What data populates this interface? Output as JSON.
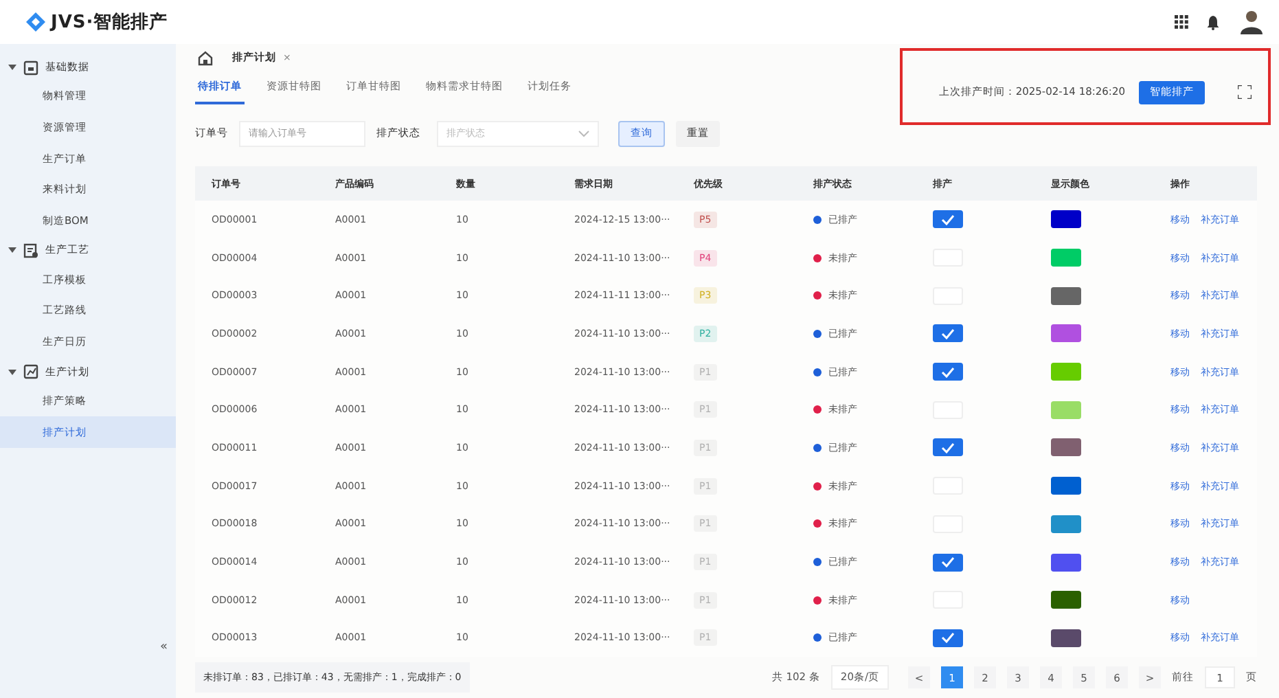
{
  "app": {
    "logo_text": "JVS·智能排产"
  },
  "sidebar": {
    "groups": [
      {
        "label": "基础数据",
        "expanded": true,
        "children": [
          {
            "label": "物料管理",
            "selected": false
          },
          {
            "label": "资源管理",
            "selected": false
          },
          {
            "label": "生产订单",
            "selected": false
          },
          {
            "label": "来料计划",
            "selected": false
          },
          {
            "label": "制造BOM",
            "selected": false
          }
        ]
      },
      {
        "label": "生产工艺",
        "expanded": true,
        "children": [
          {
            "label": "工序模板",
            "selected": false
          },
          {
            "label": "工艺路线",
            "selected": false
          },
          {
            "label": "生产日历",
            "selected": false
          }
        ]
      },
      {
        "label": "生产计划",
        "expanded": true,
        "children": [
          {
            "label": "排产策略",
            "selected": false
          },
          {
            "label": "排产计划",
            "selected": true
          }
        ]
      }
    ],
    "collapse": "«"
  },
  "breadcrumb": {
    "label": "排产计划",
    "close": "×"
  },
  "tabs": [
    {
      "label": "待排订单",
      "selected": true
    },
    {
      "label": "资源甘特图",
      "selected": false
    },
    {
      "label": "订单甘特图",
      "selected": false
    },
    {
      "label": "物料需求甘特图",
      "selected": false
    },
    {
      "label": "计划任务",
      "selected": false
    }
  ],
  "last_schedule": {
    "label": "上次排产时间：2025-02-14 18:26:20",
    "button": "智能排产"
  },
  "filters": {
    "order_label": "订单号",
    "order_placeholder": "请输入订单号",
    "status_label": "排产状态",
    "status_placeholder": "排产状态",
    "query": "查询",
    "reset": "重置"
  },
  "table": {
    "columns": [
      "订单号",
      "产品编码",
      "数量",
      "需求日期",
      "优先级",
      "排产状态",
      "排产",
      "显示颜色",
      "操作"
    ],
    "rows": [
      {
        "order": "OD00001",
        "product": "A0001",
        "qty": "10",
        "date": "2024-12-15 13:00···",
        "priority": {
          "label": "P5",
          "color": "#c0504d"
        },
        "status": "已排产",
        "scheduled": true,
        "color": "#0000c8",
        "actions": [
          "移动",
          "补充订单"
        ]
      },
      {
        "order": "OD00004",
        "product": "A0001",
        "qty": "10",
        "date": "2024-11-10 13:00···",
        "priority": {
          "label": "P4",
          "color": "#e0407a"
        },
        "status": "未排产",
        "scheduled": false,
        "color": "#00cc66",
        "actions": [
          "移动",
          "补充订单"
        ]
      },
      {
        "order": "OD00003",
        "product": "A0001",
        "qty": "10",
        "date": "2024-11-11 13:00···",
        "priority": {
          "label": "P3",
          "color": "#d0b020"
        },
        "status": "未排产",
        "scheduled": false,
        "color": "#666666",
        "actions": [
          "移动",
          "补充订单"
        ]
      },
      {
        "order": "OD00002",
        "product": "A0001",
        "qty": "10",
        "date": "2024-11-10 13:00···",
        "priority": {
          "label": "P2",
          "color": "#30b0a0"
        },
        "status": "已排产",
        "scheduled": true,
        "color": "#b050e0",
        "actions": [
          "移动",
          "补充订单"
        ]
      },
      {
        "order": "OD00007",
        "product": "A0001",
        "qty": "10",
        "date": "2024-11-10 13:00···",
        "priority": {
          "label": "P1",
          "color": "#b0b0b0"
        },
        "status": "已排产",
        "scheduled": true,
        "color": "#66cc00",
        "actions": [
          "移动",
          "补充订单"
        ]
      },
      {
        "order": "OD00006",
        "product": "A0001",
        "qty": "10",
        "date": "2024-11-10 13:00···",
        "priority": {
          "label": "P1",
          "color": "#b0b0b0"
        },
        "status": "未排产",
        "scheduled": false,
        "color": "#99dd66",
        "actions": [
          "移动",
          "补充订单"
        ]
      },
      {
        "order": "OD00011",
        "product": "A0001",
        "qty": "10",
        "date": "2024-11-10 13:00···",
        "priority": {
          "label": "P1",
          "color": "#b0b0b0"
        },
        "status": "已排产",
        "scheduled": true,
        "color": "#806070",
        "actions": [
          "移动",
          "补充订单"
        ]
      },
      {
        "order": "OD00017",
        "product": "A0001",
        "qty": "10",
        "date": "2024-11-10 13:00···",
        "priority": {
          "label": "P1",
          "color": "#b0b0b0"
        },
        "status": "未排产",
        "scheduled": false,
        "color": "#0060d0",
        "actions": [
          "移动",
          "补充订单"
        ]
      },
      {
        "order": "OD00018",
        "product": "A0001",
        "qty": "10",
        "date": "2024-11-10 13:00···",
        "priority": {
          "label": "P1",
          "color": "#b0b0b0"
        },
        "status": "未排产",
        "scheduled": false,
        "color": "#2090c8",
        "actions": [
          "移动",
          "补充订单"
        ]
      },
      {
        "order": "OD00014",
        "product": "A0001",
        "qty": "10",
        "date": "2024-11-10 13:00···",
        "priority": {
          "label": "P1",
          "color": "#b0b0b0"
        },
        "status": "已排产",
        "scheduled": true,
        "color": "#5050f0",
        "actions": [
          "移动",
          "补充订单"
        ]
      },
      {
        "order": "OD00012",
        "product": "A0001",
        "qty": "10",
        "date": "2024-11-10 13:00···",
        "priority": {
          "label": "P1",
          "color": "#b0b0b0"
        },
        "status": "未排产",
        "scheduled": false,
        "color": "#2a6000",
        "actions": [
          "移动"
        ]
      },
      {
        "order": "OD00013",
        "product": "A0001",
        "qty": "10",
        "date": "2024-11-10 13:00···",
        "priority": {
          "label": "P1",
          "color": "#b0b0b0"
        },
        "status": "已排产",
        "scheduled": true,
        "color": "#5a4a6a",
        "actions": [
          "移动",
          "补充订单"
        ]
      }
    ]
  },
  "summary": "未排订单：83，已排订单：43，无需排产：1，完成排产：0",
  "pagination": {
    "total": "共 102 条",
    "page_size": "20条/页",
    "prev": "<",
    "pages": [
      {
        "label": "1",
        "selected": true
      },
      {
        "label": "2",
        "selected": false
      },
      {
        "label": "3",
        "selected": false
      },
      {
        "label": "4",
        "selected": false
      },
      {
        "label": "5",
        "selected": false
      },
      {
        "label": "6",
        "selected": false
      }
    ],
    "next": ">",
    "goto_label": "前往",
    "goto_value": "1",
    "goto_unit": "页"
  }
}
